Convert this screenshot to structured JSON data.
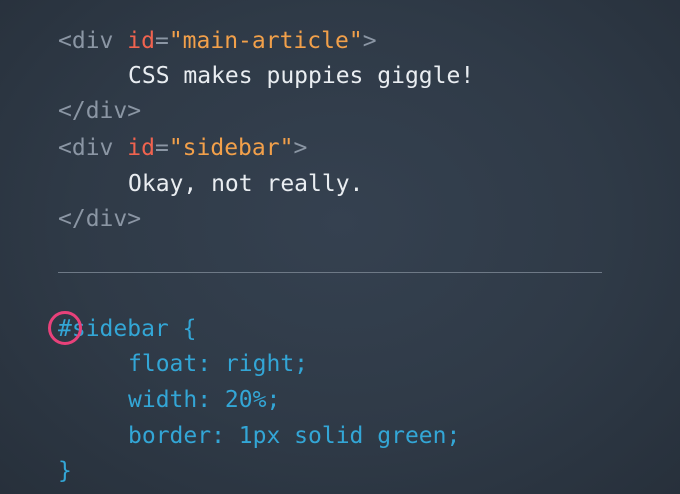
{
  "html_snippet": {
    "line1": {
      "open": "<div",
      "attr": "id",
      "eq": "=",
      "value": "\"main-article\"",
      "close": ">"
    },
    "line2": "CSS makes puppies giggle!",
    "line3": "</div>",
    "line4": {
      "open": "<div",
      "attr": "id",
      "eq": "=",
      "value": "\"sidebar\"",
      "close": ">"
    },
    "line5": "Okay, not really.",
    "line6": "</div>"
  },
  "css_snippet": {
    "selector": "#sidebar {",
    "decl1": "float: right;",
    "decl2": "width: 20%;",
    "decl3": "border: 1px solid green;",
    "closing": "}"
  },
  "colors": {
    "background": "#2f3a47",
    "tag": "#8b96a4",
    "attribute": "#f0634f",
    "string": "#f2a04a",
    "text": "#e9edf1",
    "css": "#33a6d6",
    "highlight_ring": "#e8417a"
  }
}
